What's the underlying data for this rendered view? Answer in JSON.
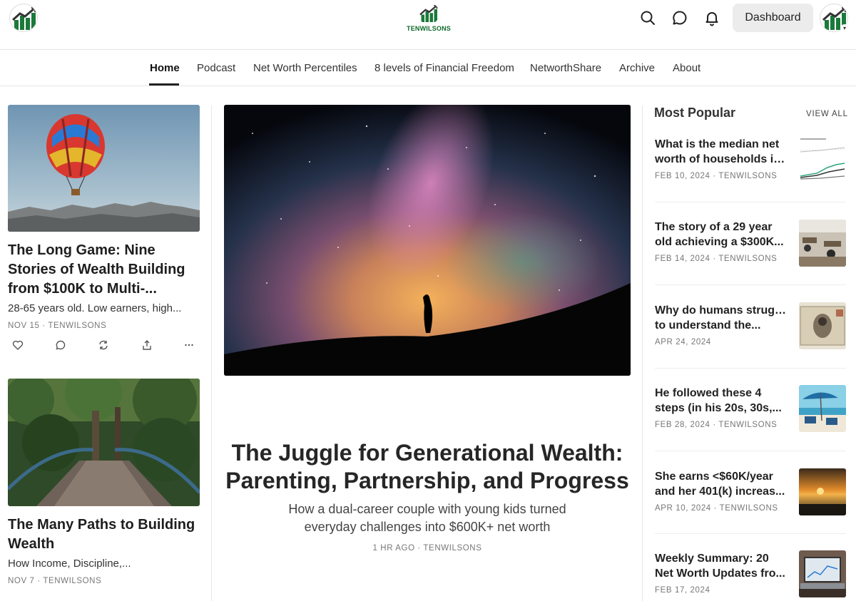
{
  "brand": {
    "wordmark": "TENWILSONS"
  },
  "header": {
    "dashboard_label": "Dashboard",
    "icons": [
      "search-icon",
      "chat-icon",
      "bell-icon"
    ]
  },
  "nav": {
    "items": [
      {
        "label": "Home",
        "active": true
      },
      {
        "label": "Podcast"
      },
      {
        "label": "Net Worth Percentiles"
      },
      {
        "label": "8 levels of Financial Freedom"
      },
      {
        "label": "NetworthShare"
      },
      {
        "label": "Archive"
      },
      {
        "label": "About"
      }
    ]
  },
  "left_posts": [
    {
      "title_lines": [
        "The Long Game: Nine",
        "Stories of Wealth Building",
        "from $100K to Multi-..."
      ],
      "subtitle": "28-65 years old. Low earners, high...",
      "meta": "NOV 15 · TENWILSONS"
    },
    {
      "title_lines": [
        "The Many Paths to Building",
        "Wealth"
      ],
      "subtitle": "How Income, Discipline,...",
      "meta": "NOV 7 · TENWILSONS"
    }
  ],
  "hero": {
    "title_lines": [
      "The Juggle for Generational Wealth:",
      "Parenting, Partnership, and Progress"
    ],
    "subtitle_lines": [
      "How a dual-career couple with young kids turned",
      "everyday challenges into $600K+ net worth"
    ],
    "meta": "1 HR AGO · TENWILSONS"
  },
  "popular": {
    "heading": "Most Popular",
    "view_all": "VIEW ALL",
    "items": [
      {
        "title_lines": [
          "What is the median net",
          "worth of households in..."
        ],
        "meta": "FEB 10, 2024 · TENWILSONS",
        "thumb": "chart-thumb"
      },
      {
        "title_lines": [
          "The story of a 29 year",
          "old achieving a $300K..."
        ],
        "meta": "FEB 14, 2024 · TENWILSONS",
        "thumb": "office-thumb"
      },
      {
        "title_lines": [
          "Why do humans struggle",
          "to understand the..."
        ],
        "meta": "APR 24, 2024",
        "thumb": "banknote-thumb"
      },
      {
        "title_lines": [
          "He followed these 4",
          "steps (in his 20s, 30s,..."
        ],
        "meta": "FEB 28, 2024 · TENWILSONS",
        "thumb": "beach-thumb"
      },
      {
        "title_lines": [
          "She earns <$60K/year",
          "and her 401(k) increas..."
        ],
        "meta": "APR 10, 2024 · TENWILSONS",
        "thumb": "sunset-thumb"
      },
      {
        "title_lines": [
          "Weekly Summary: 20",
          "Net Worth Updates fro..."
        ],
        "meta": "FEB 17, 2024",
        "thumb": "laptop-thumb"
      }
    ]
  },
  "colors": {
    "brand_green": "#0d6b2b",
    "text": "#1e1e1e",
    "muted": "#777777"
  }
}
